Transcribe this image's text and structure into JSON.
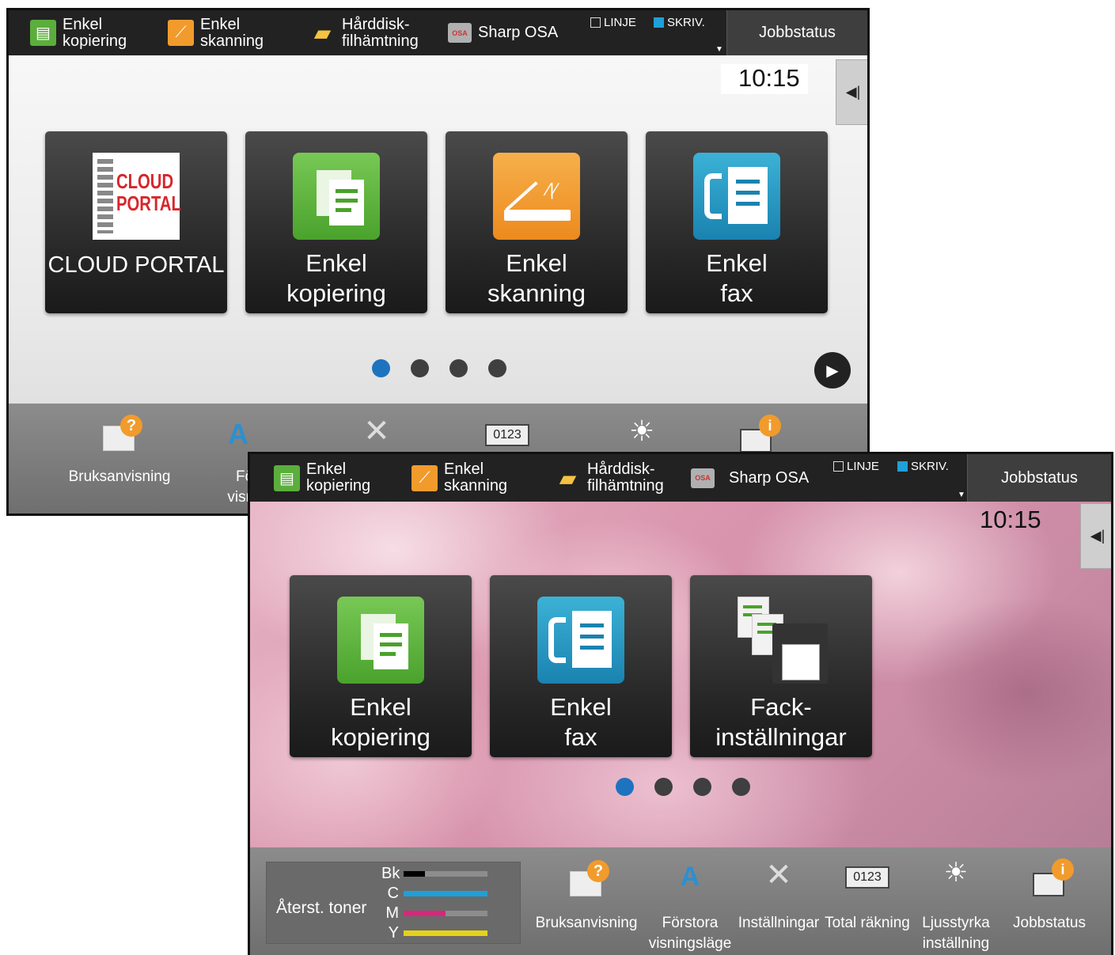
{
  "topbar": {
    "shortcuts": [
      {
        "label": "Enkel\nkopiering",
        "icon": "copy-icon"
      },
      {
        "label": "Enkel\nskanning",
        "icon": "scan-icon"
      },
      {
        "label": "Hårddisk-\nfilhämtning",
        "icon": "folder-icon"
      },
      {
        "label": "Sharp OSA",
        "icon": "osa-icon"
      }
    ],
    "indicator_linje": "LINJE",
    "indicator_skriv": "SKRIV.",
    "osa_badge": "OSA",
    "job_status": "Jobbstatus"
  },
  "clock": "10:15",
  "side_toggle_glyph": "◀|",
  "back_screen": {
    "tiles": [
      {
        "label": "CLOUD PORTAL",
        "icon": "cloud-portal-logo"
      },
      {
        "label": "Enkel\nkopiering",
        "icon": "copy-icon"
      },
      {
        "label": "Enkel\nskanning",
        "icon": "scan-icon"
      },
      {
        "label": "Enkel\nfax",
        "icon": "fax-icon"
      }
    ],
    "cloud_logo_text_1": "CLOUD",
    "cloud_logo_text_2": "PORTAL",
    "page_dots": 4,
    "active_page": 1,
    "bottom_items": [
      {
        "label": "Bruksanvisning",
        "icon": "manual-icon"
      },
      {
        "label": "Förs\nvisnin",
        "icon": "magnify-text-icon"
      }
    ]
  },
  "front_screen": {
    "tiles": [
      {
        "label": "Enkel\nkopiering",
        "icon": "copy-icon"
      },
      {
        "label": "Enkel\nfax",
        "icon": "fax-icon"
      },
      {
        "label": "Fack-\ninställningar",
        "icon": "tray-settings-icon"
      }
    ],
    "page_dots": 4,
    "active_page": 1,
    "toner": {
      "title": "Återst. toner",
      "levels": [
        {
          "key": "Bk",
          "color": "#000000",
          "level": 0.25
        },
        {
          "key": "C",
          "color": "#1fa0d8",
          "level": 1.0
        },
        {
          "key": "M",
          "color": "#d6287a",
          "level": 0.5
        },
        {
          "key": "Y",
          "color": "#e5d21a",
          "level": 1.0
        }
      ]
    },
    "bottom_items": [
      {
        "label": "Bruksanvisning",
        "icon": "manual-icon"
      },
      {
        "label": "Förstora\nvisningsläge",
        "icon": "magnify-text-icon"
      },
      {
        "label": "Inställningar",
        "icon": "wrench-screwdriver-icon"
      },
      {
        "label": "Total räkning",
        "icon": "counter-icon"
      },
      {
        "label": "Ljusstyrka\ninställning",
        "icon": "brightness-icon"
      },
      {
        "label": "Jobbstatus",
        "icon": "job-status-icon"
      }
    ],
    "counter_digits": "0123"
  }
}
